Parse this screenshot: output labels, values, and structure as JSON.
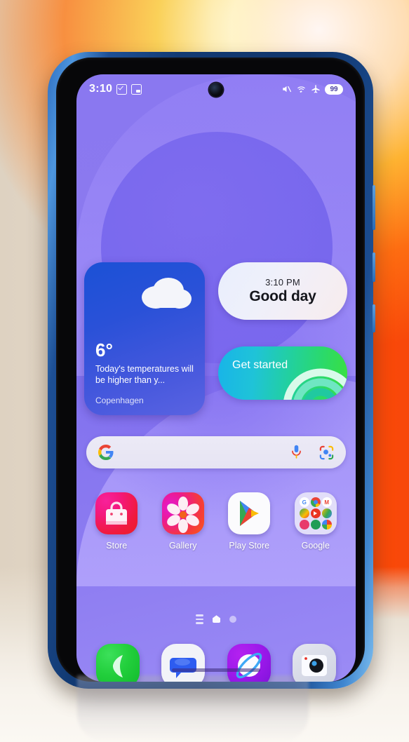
{
  "device": {
    "name": "android-phone",
    "frame_color": "#1d4f95"
  },
  "status_bar": {
    "time": "3:10",
    "left_icons": [
      "checkbox-checked-icon",
      "picture-in-picture-icon"
    ],
    "right_icons": [
      "volume-mute-icon",
      "wifi-icon",
      "airplane-mode-icon"
    ],
    "battery_level": "99"
  },
  "wallpaper": {
    "base_color": "#8a78f0",
    "accent_color": "#7b68ee"
  },
  "widgets": {
    "weather": {
      "temperature": "6°",
      "description": "Today's temperatures will be higher than y...",
      "city": "Copenhagen",
      "icon": "cloud-icon",
      "bg_color": "#1b51d6"
    },
    "clock": {
      "time": "3:10 PM",
      "greeting": "Good day"
    },
    "get_started": {
      "label": "Get started",
      "bg_color": "#22d09f"
    }
  },
  "search": {
    "placeholder": "",
    "value": "",
    "icons": [
      "google-g-icon",
      "microphone-icon",
      "google-lens-icon"
    ]
  },
  "apps": [
    {
      "label": "Store",
      "icon": "store-icon"
    },
    {
      "label": "Gallery",
      "icon": "gallery-icon"
    },
    {
      "label": "Play Store",
      "icon": "play-store-icon"
    },
    {
      "label": "Google",
      "icon": "google-folder-icon"
    }
  ],
  "folder_apps": [
    {
      "name": "Google",
      "glyph": "G"
    },
    {
      "name": "Chrome",
      "glyph": ""
    },
    {
      "name": "Gmail",
      "glyph": "M"
    },
    {
      "name": "Maps",
      "glyph": ""
    },
    {
      "name": "YouTube",
      "glyph": ""
    },
    {
      "name": "Drive",
      "glyph": ""
    },
    {
      "name": "Photos",
      "glyph": ""
    },
    {
      "name": "Meet",
      "glyph": ""
    },
    {
      "name": "Gallery",
      "glyph": ""
    }
  ],
  "page_indicator": {
    "pages": [
      "app-list-page",
      "home-page",
      "third-page"
    ],
    "active_index": 1
  },
  "dock": [
    {
      "label": "Phone",
      "icon": "phone-icon"
    },
    {
      "label": "Messages",
      "icon": "messages-icon"
    },
    {
      "label": "Browser",
      "icon": "browser-icon"
    },
    {
      "label": "Camera",
      "icon": "camera-icon"
    }
  ]
}
